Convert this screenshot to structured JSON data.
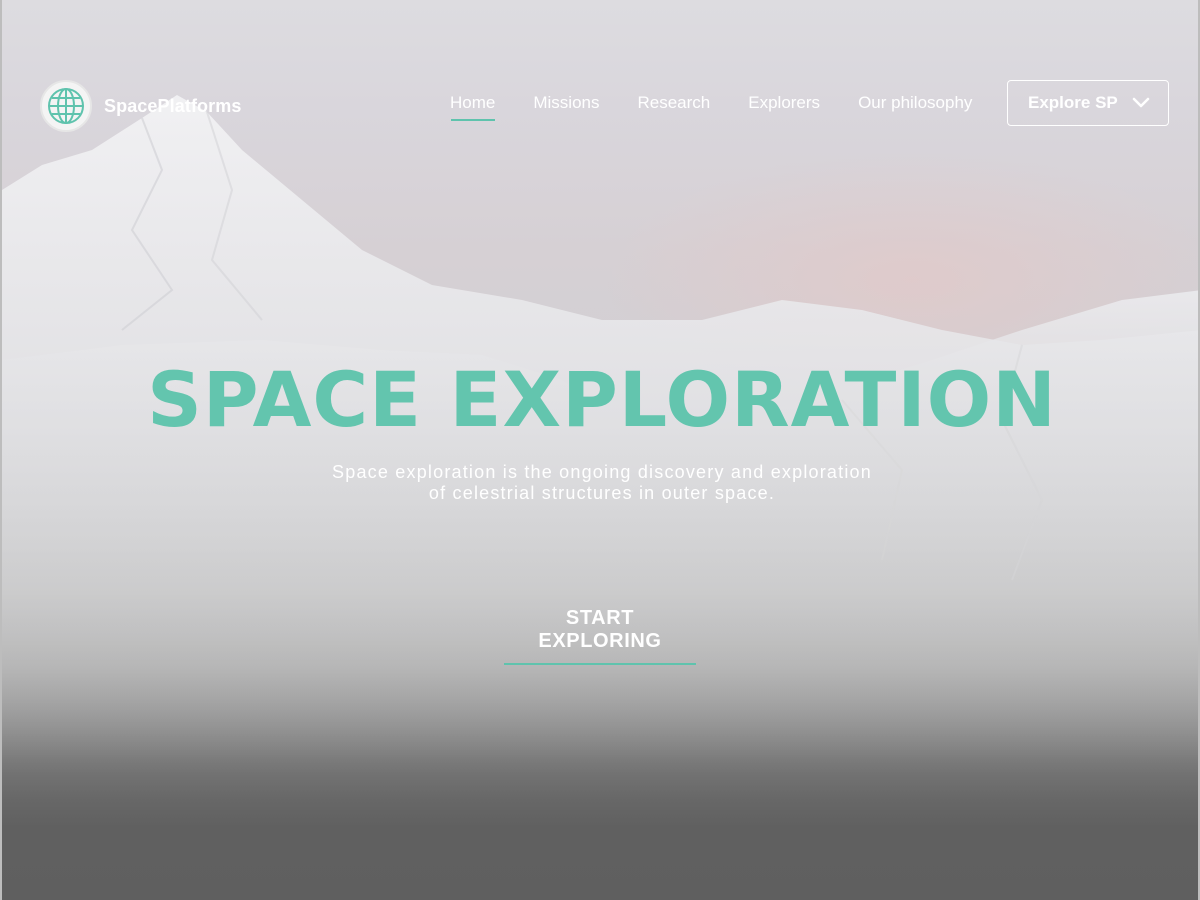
{
  "brand": {
    "name": "SpacePlatforms",
    "icon": "globe-icon"
  },
  "nav": {
    "items": [
      {
        "label": "Home",
        "active": true
      },
      {
        "label": "Missions",
        "active": false
      },
      {
        "label": "Research",
        "active": false
      },
      {
        "label": "Explorers",
        "active": false
      },
      {
        "label": "Our philosophy",
        "active": false
      }
    ],
    "dropdown": {
      "label": "Explore SP",
      "icon": "chevron-down-icon"
    }
  },
  "hero": {
    "title": "SPACE EXPLORATION",
    "subtitle_line1": "Space exploration is the ongoing discovery and exploration",
    "subtitle_line2": "of celestrial structures in outer space.",
    "cta_label": "START EXPLORING"
  },
  "colors": {
    "accent": "#63c5ae",
    "text": "#ffffff",
    "background_bottom": "#5f5f5f"
  }
}
